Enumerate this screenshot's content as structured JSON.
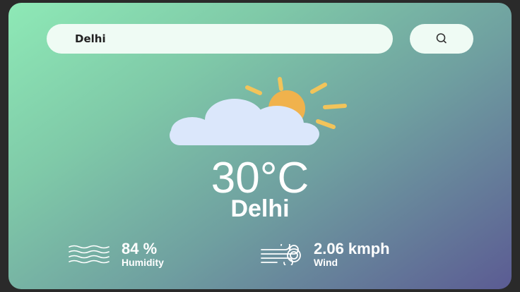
{
  "search": {
    "value": "Delhi",
    "button_icon": "search-icon"
  },
  "weather": {
    "icon": "partly-cloudy-icon",
    "temperature": "30°C",
    "city": "Delhi"
  },
  "humidity": {
    "icon": "humidity-waves-icon",
    "value": "84 %",
    "label": "Humidity"
  },
  "wind": {
    "icon": "wind-icon",
    "value": "2.06 kmph",
    "label": "Wind"
  },
  "colors": {
    "gradient_start": "#8ee9b6",
    "gradient_end": "#5b5b93",
    "sun": "#f2b54b",
    "cloud": "#dbe7fb",
    "pill": "#effbf4"
  }
}
